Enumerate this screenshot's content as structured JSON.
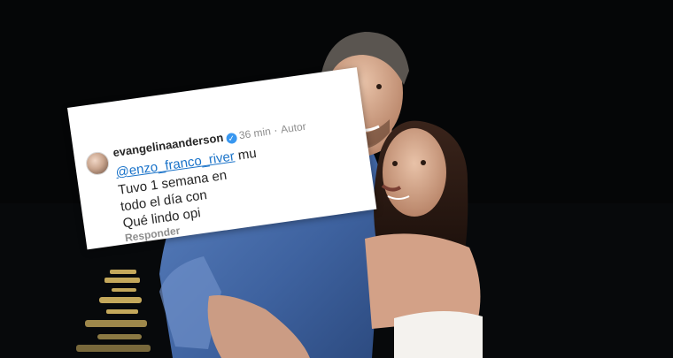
{
  "comment": {
    "username": "evangelinaanderson",
    "verified_icon": "verified-badge-icon",
    "time": "36 min",
    "separator": "·",
    "author_tag": "Autor",
    "mention": "@enzo_franco_river",
    "mention_tail": " mu",
    "line2": "Tuvo 1 semana en",
    "line3": "todo el día con",
    "line4": "Qué lindo opi",
    "reply_label": "Responder"
  },
  "colors": {
    "card_bg": "#ffffff",
    "mention": "#1a73c9",
    "verified": "#3897f0",
    "background": "#050607"
  }
}
